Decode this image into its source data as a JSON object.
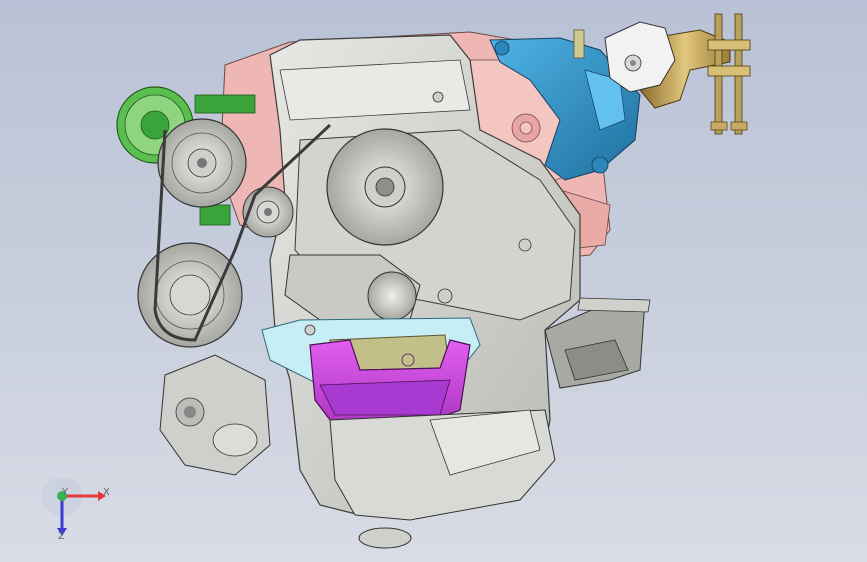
{
  "viewport": {
    "background_top": "#b9c2d6",
    "background_bottom": "#d9dce6"
  },
  "model": {
    "colors": {
      "block": "#d6d6d2",
      "block_dark": "#a9a9a4",
      "head_pink": "#efb7b3",
      "bracket_blue": "#2f8fc6",
      "mount_gold": "#c9a85a",
      "mount_white": "#f2f2f2",
      "tensioner_green": "#3aa33a",
      "mount_magenta": "#c734d9",
      "mount_purple": "#a83ad1",
      "manifold_cyan": "#c7eef5",
      "olive_plate": "#c3bf88",
      "steel": "#b7b7b7"
    }
  },
  "triad": {
    "x_label": "X",
    "y_label": "Y",
    "z_label": "Z",
    "x_color": "#e23a3a",
    "y_color": "#37b24d",
    "z_color": "#3b3bd6"
  }
}
